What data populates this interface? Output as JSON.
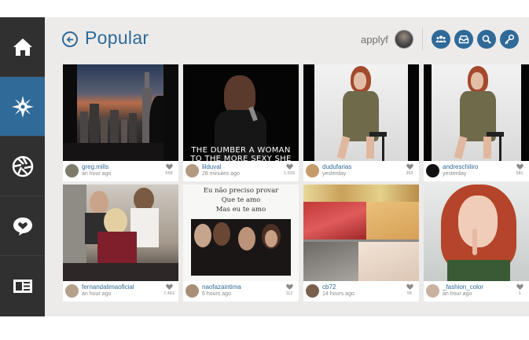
{
  "header": {
    "title": "Popular",
    "username": "applyf"
  },
  "sidebar": {
    "items": [
      {
        "icon": "home-icon"
      },
      {
        "icon": "compass-icon",
        "active": true
      },
      {
        "icon": "aperture-icon"
      },
      {
        "icon": "chat-heart-icon"
      },
      {
        "icon": "newspaper-icon"
      }
    ]
  },
  "toolbar": {
    "buttons": [
      "people-icon",
      "inbox-icon",
      "search-icon",
      "key-icon"
    ]
  },
  "colors": {
    "accent": "#2f6a98",
    "sidebar": "#303030",
    "background": "#ecebea"
  },
  "posts": [
    {
      "user": "greg.mills",
      "time": "an hour ago",
      "likes": "556"
    },
    {
      "user": "lilduval",
      "time": "28 minutes ago",
      "likes": "1,033",
      "caption": [
        "THE DUMBER A WOMAN",
        "TO THE MORE SEXY SHE"
      ]
    },
    {
      "user": "dudufarias",
      "time": "yesterday",
      "likes": "363"
    },
    {
      "user": "andreschiliro",
      "time": "yesterday",
      "likes": "581"
    },
    {
      "user": "fernandalimaoficial",
      "time": "an hour ago",
      "likes": "7,491"
    },
    {
      "user": "naofazaintima",
      "time": "6 hours ago",
      "likes": "112",
      "handwritten": [
        "Eu não preciso provar",
        "Que te amo",
        "Mas eu te amo"
      ]
    },
    {
      "user": "cb72",
      "time": "14 hours ago",
      "likes": "55"
    },
    {
      "user": "_fashion_color",
      "time": "an hour ago",
      "likes": "1"
    }
  ]
}
